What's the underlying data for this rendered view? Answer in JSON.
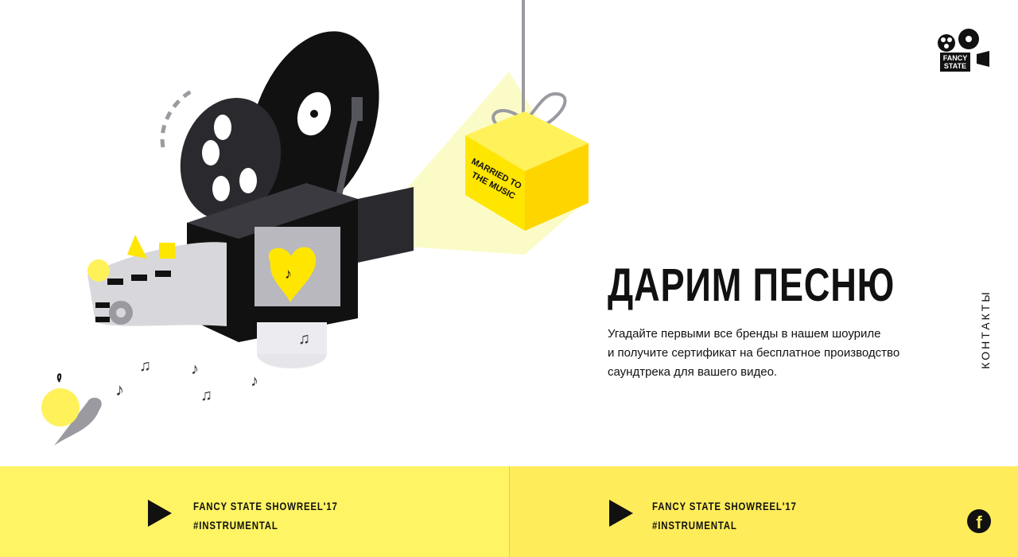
{
  "brand": {
    "logo_line1": "FANCY",
    "logo_line2": "STATE"
  },
  "hero": {
    "title": "ДАРИМ ПЕСНЮ",
    "description_lines": [
      "Угадайте первыми все бренды в нашем шоуриле",
      "и получите сертификат на бесплатное производство",
      "саундтрека для вашего видео."
    ],
    "gift_box_label_line1": "MARRIED TO",
    "gift_box_label_line2": "THE MUSIC"
  },
  "nav": {
    "contacts_label": "КОНТАКТЫ"
  },
  "players": [
    {
      "title": "FANCY STATE SHOWREEL'17",
      "tag": "#INSTRUMENTAL",
      "icon": "play-icon"
    },
    {
      "title": "FANCY STATE SHOWREEL'17",
      "tag": "#INSTRUMENTAL",
      "icon": "play-icon"
    }
  ],
  "social": {
    "facebook_icon": "facebook-icon",
    "facebook_glyph": "f"
  },
  "colors": {
    "accent_yellow": "#ffec00",
    "bar_left": "#fff463",
    "bar_right": "#ffec5a",
    "dark": "#111111"
  }
}
